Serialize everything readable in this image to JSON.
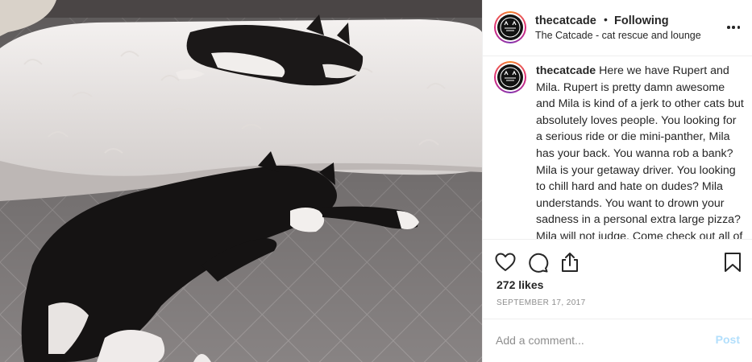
{
  "post": {
    "username": "thecatcade",
    "follow_separator": "•",
    "follow_status": "Following",
    "location_subtitle": "The Catcade - cat rescue and lounge",
    "caption_username": "thecatcade",
    "caption_text": "Here we have Rupert and Mila. Rupert is pretty damn awesome and Mila is kind of a jerk to other cats but absolutely loves people. You looking for a serious ride or die mini-panther, Mila has your back. You wanna rob a bank? Mila is your getaway driver. You looking to chill hard and hate on dudes? Mila understands. You want to drown your sadness in a personal extra large pizza? Mila will not judge. Come check out all of our factory",
    "likes": "272 likes",
    "date": "SEPTEMBER 17, 2017"
  },
  "actions": {
    "like_icon": "heart-outline-icon",
    "comment_icon": "speech-bubble-icon",
    "share_icon": "share-upload-icon",
    "save_icon": "bookmark-outline-icon"
  },
  "comment": {
    "placeholder": "Add a comment...",
    "post_label": "Post"
  },
  "colors": {
    "text": "#262626",
    "secondary": "#8e8e8e",
    "post_disabled": "#b2dffc",
    "divider": "#efefef"
  }
}
